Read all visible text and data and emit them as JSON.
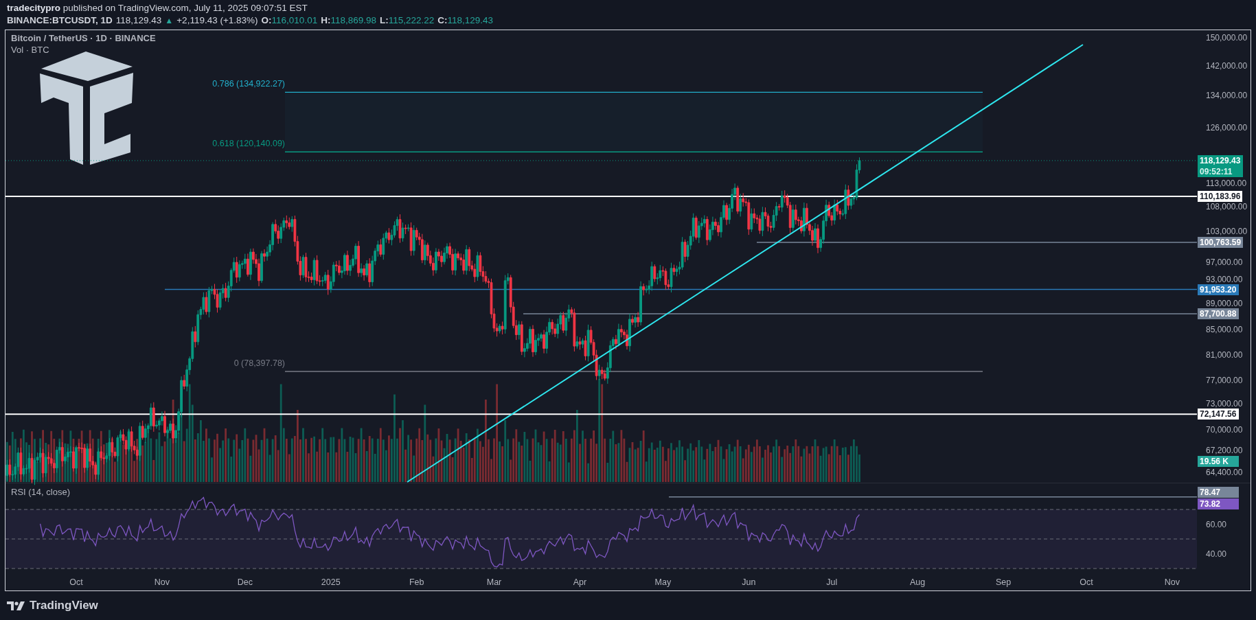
{
  "header": {
    "publisher": "tradecitypro",
    "text": "published on TradingView.com, July 11, 2025 09:07:51 EST"
  },
  "quote": {
    "symbol": "BINANCE:BTCUSDT, 1D",
    "last": "118,129.43",
    "arrow": "▲",
    "change": "+2,119.43 (+1.83%)",
    "ohlc": [
      {
        "label": "O:",
        "value": "116,010.01"
      },
      {
        "label": "H:",
        "value": "118,869.98"
      },
      {
        "label": "L:",
        "value": "115,222.22"
      },
      {
        "label": "C:",
        "value": "118,129.43"
      }
    ]
  },
  "chart": {
    "title": "Bitcoin / TetherUS · 1D · BINANCE",
    "volume_legend": "Vol · BTC",
    "price_ticks": [
      "150,000.00",
      "142,000.00",
      "134,000.00",
      "126,000.00",
      "113,000.00",
      "108,000.00",
      "103,000.00",
      "97,000.00",
      "93,000.00",
      "89,000.00",
      "85,000.00",
      "81,000.00",
      "77,000.00",
      "73,000.00",
      "70,000.00",
      "67,200.00",
      "64,400.00"
    ],
    "current_price": {
      "price": "118,129.43",
      "countdown": "09:52:11"
    },
    "levels": [
      {
        "label": "110,183.96",
        "color": "#ffffff"
      },
      {
        "label": "100,763.59",
        "color": "#788699"
      },
      {
        "label": "91,953.20",
        "color": "#2a7ab8"
      },
      {
        "label": "87,700.88",
        "color": "#788699"
      },
      {
        "label": "72,147.56",
        "color": "#ffffff"
      }
    ],
    "fib_levels": [
      {
        "label": "0.786 (134,922.27)",
        "color": "#22b0cc"
      },
      {
        "label": "0.618 (120,140.09)",
        "color": "#089981"
      },
      {
        "label": "0 (78,397.78)",
        "color": "#787b86"
      }
    ],
    "volume_label": "19.56 K"
  },
  "rsi": {
    "legend": "RSI (14, close)",
    "ticks": [
      "60.00",
      "40.00"
    ],
    "labels": [
      {
        "text": "78.47",
        "color": "#788699"
      },
      {
        "text": "73.82",
        "color": "#7e57c2"
      }
    ]
  },
  "time_axis": [
    "Oct",
    "Nov",
    "Dec",
    "2025",
    "Feb",
    "Mar",
    "Apr",
    "May",
    "Jun",
    "Jul",
    "Aug",
    "Sep",
    "Oct",
    "Nov"
  ],
  "footer": {
    "brand": "TradingView"
  }
}
